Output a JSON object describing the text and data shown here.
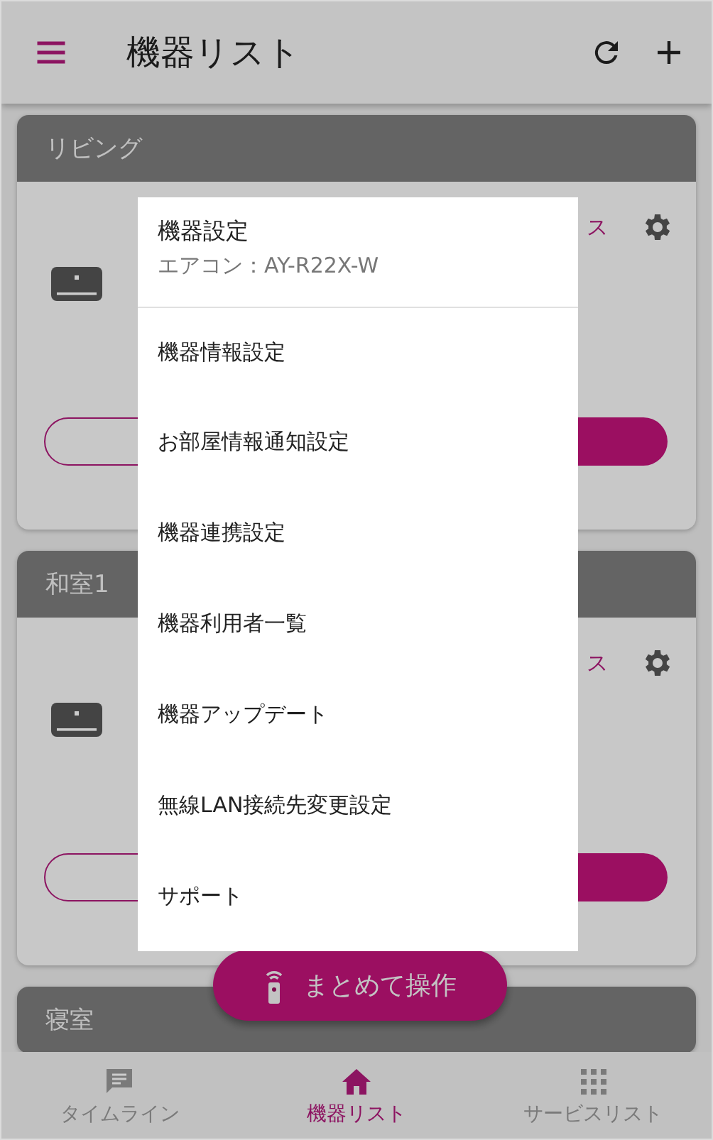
{
  "header": {
    "title": "機器リスト"
  },
  "rooms": [
    {
      "name": "リビング",
      "link": "ス"
    },
    {
      "name": "和室1",
      "link": "ス"
    },
    {
      "name": "寝室"
    }
  ],
  "menu": {
    "title": "機器設定",
    "subtitle": "エアコン：AY-R22X-W",
    "items": [
      "機器情報設定",
      "お部屋情報通知設定",
      "機器連携設定",
      "機器利用者一覧",
      "機器アップデート",
      "無線LAN接続先変更設定",
      "サポート"
    ]
  },
  "fab": {
    "label": "まとめて操作"
  },
  "bottom_nav": [
    {
      "label": "タイムライン",
      "selected": false
    },
    {
      "label": "機器リスト",
      "selected": true
    },
    {
      "label": "サービスリスト",
      "selected": false
    }
  ]
}
